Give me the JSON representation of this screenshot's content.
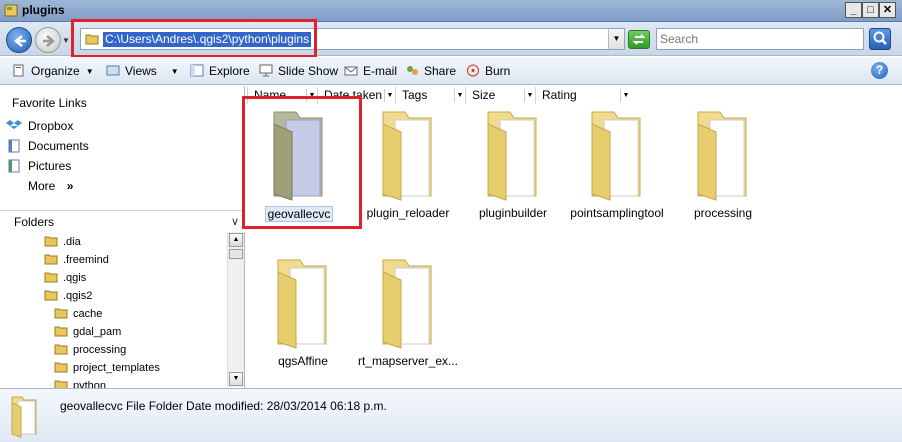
{
  "window": {
    "title": "plugins"
  },
  "address": {
    "path": "C:\\Users\\Andres\\.qgis2\\python\\plugins",
    "search_placeholder": "Search"
  },
  "toolbar": {
    "organize": "Organize",
    "views": "Views",
    "explore": "Explore",
    "slideshow": "Slide Show",
    "email": "E-mail",
    "share": "Share",
    "burn": "Burn"
  },
  "favorites": {
    "heading": "Favorite Links",
    "items": [
      {
        "label": "Dropbox"
      },
      {
        "label": "Documents"
      },
      {
        "label": "Pictures"
      }
    ],
    "more": "More",
    "more_glyph": "»"
  },
  "folders_pane": {
    "heading": "Folders",
    "items": [
      {
        "label": ".dia"
      },
      {
        "label": ".freemind"
      },
      {
        "label": ".qgis"
      },
      {
        "label": ".qgis2"
      },
      {
        "label": "cache"
      },
      {
        "label": "gdal_pam"
      },
      {
        "label": "processing"
      },
      {
        "label": "project_templates"
      },
      {
        "label": "python"
      }
    ]
  },
  "columns": [
    {
      "label": "Name"
    },
    {
      "label": "Date taken"
    },
    {
      "label": "Tags"
    },
    {
      "label": "Size"
    },
    {
      "label": "Rating"
    }
  ],
  "files": [
    {
      "name": "geovallecvc",
      "selected": true
    },
    {
      "name": "plugin_reloader"
    },
    {
      "name": "pluginbuilder"
    },
    {
      "name": "pointsamplingtool"
    },
    {
      "name": "processing"
    },
    {
      "name": "qgsAffine"
    },
    {
      "name": "rt_mapserver_ex..."
    }
  ],
  "details": {
    "text": "geovallecvc File Folder Date modified: 28/03/2014 06:18 p.m."
  },
  "colors": {
    "highlight": "#e0202a",
    "selection": "#3366cc"
  }
}
